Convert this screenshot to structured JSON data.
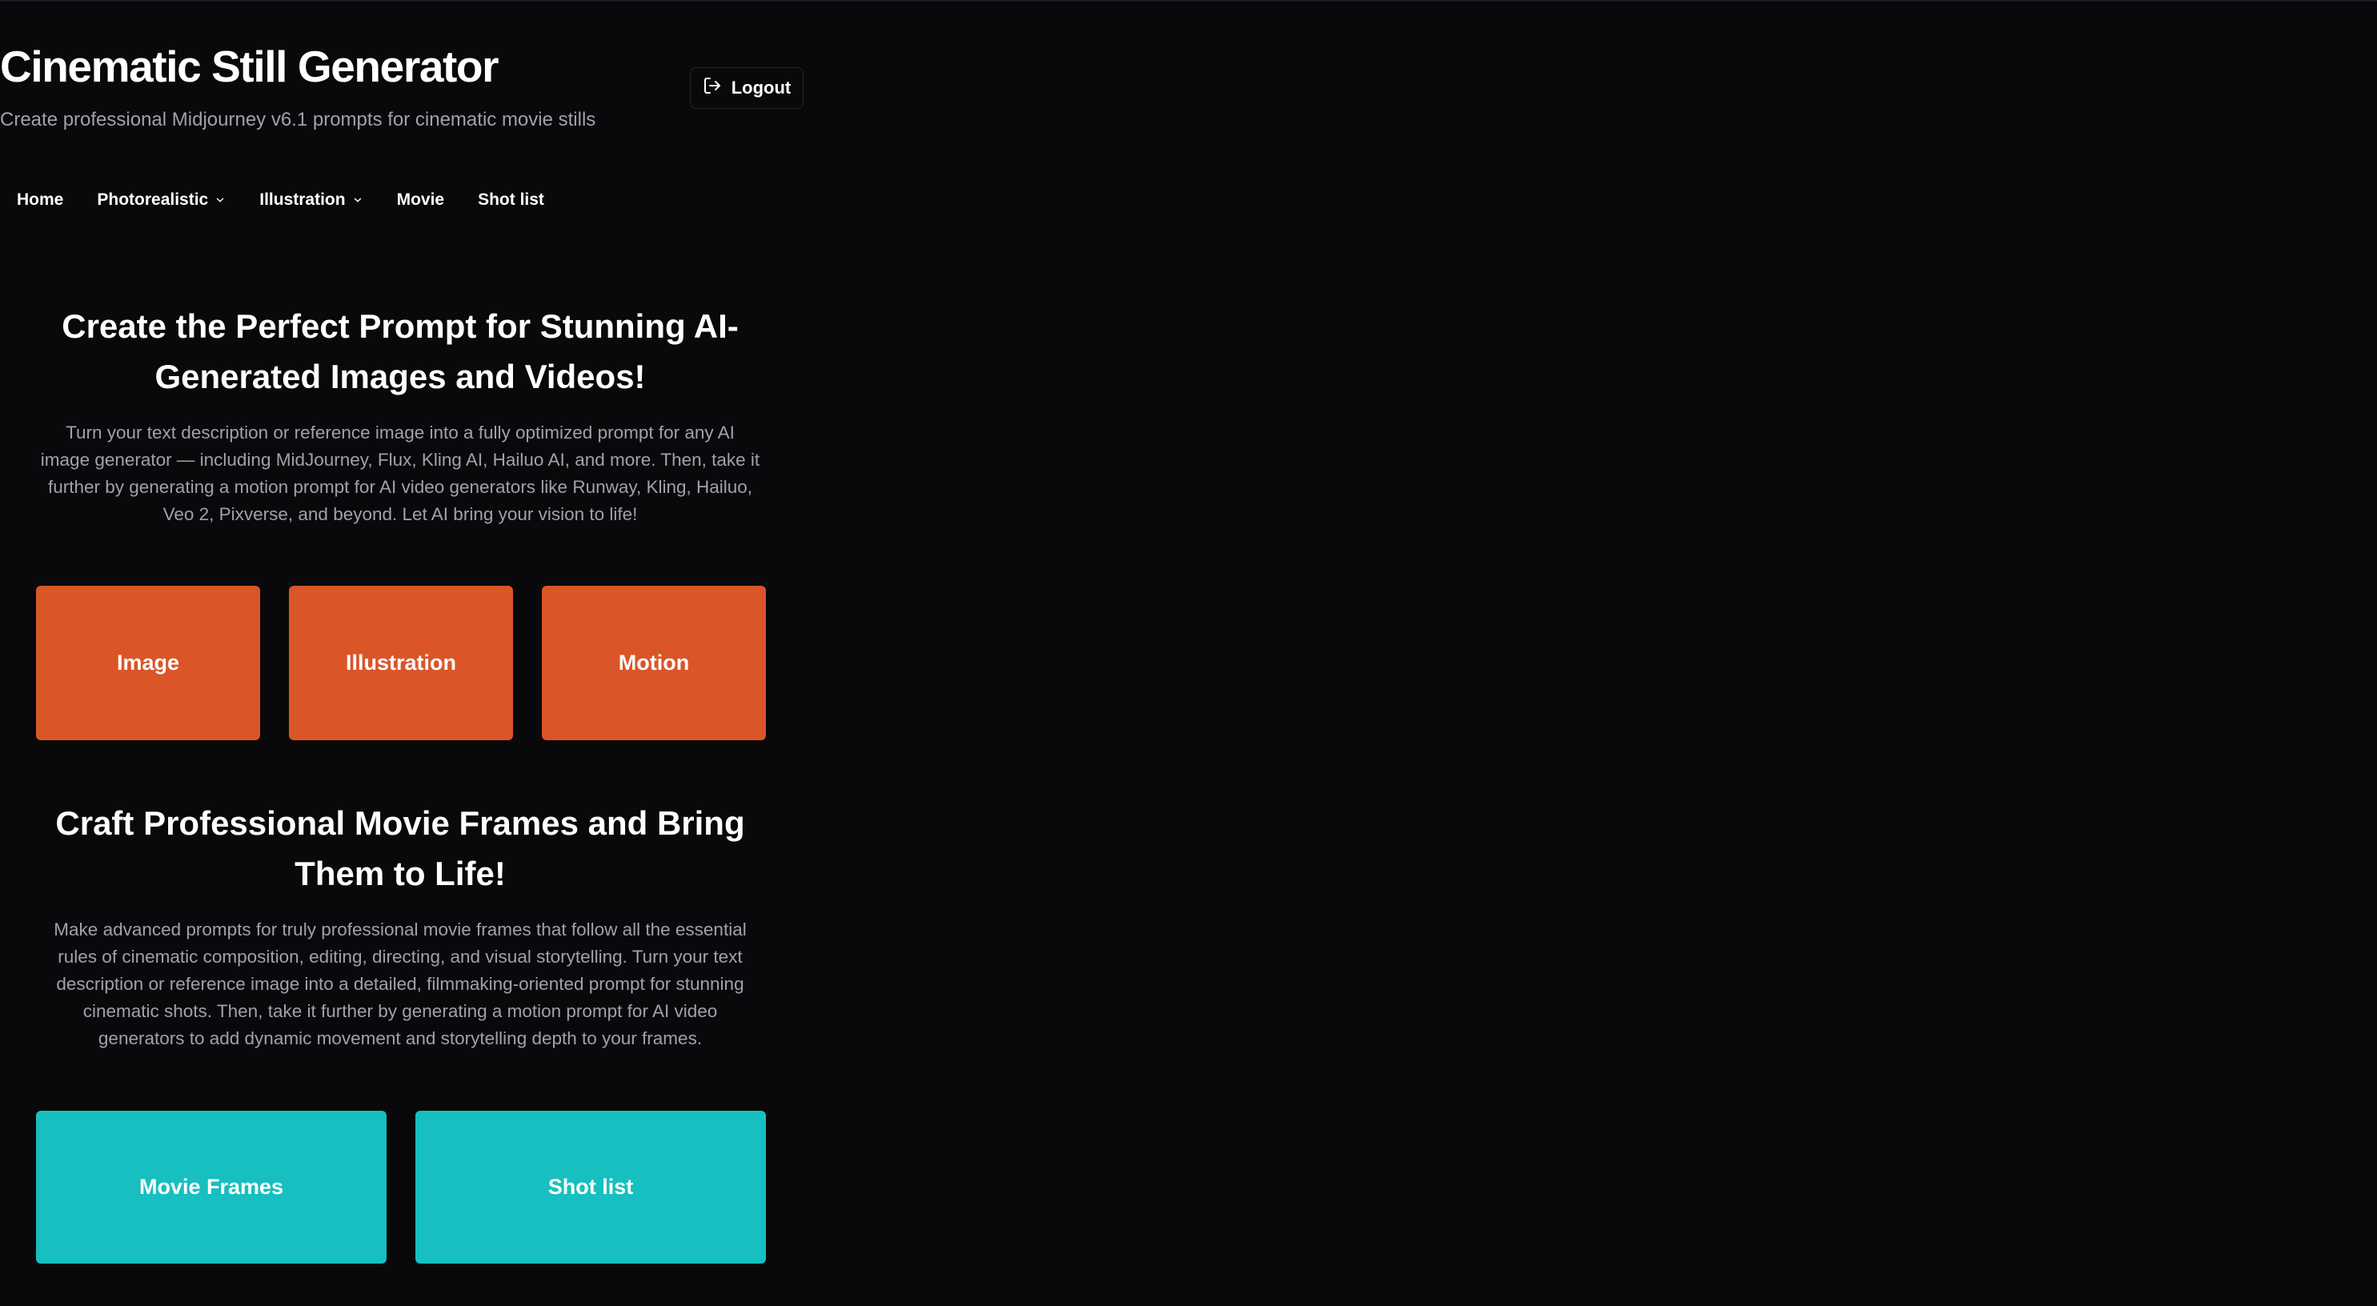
{
  "header": {
    "title": "Cinematic Still Generator",
    "subtitle": "Create professional Midjourney v6.1 prompts for cinematic movie stills",
    "logout_label": "Logout"
  },
  "nav": {
    "items": [
      {
        "label": "Home",
        "has_dropdown": false
      },
      {
        "label": "Photorealistic",
        "has_dropdown": true
      },
      {
        "label": "Illustration",
        "has_dropdown": true
      },
      {
        "label": "Movie",
        "has_dropdown": false
      },
      {
        "label": "Shot list",
        "has_dropdown": false
      }
    ]
  },
  "section_images": {
    "heading": "Create the Perfect Prompt for Stunning AI-Generated Images and Videos!",
    "description": "Turn your text description or reference image into a fully optimized prompt for any AI image generator — including MidJourney, Flux, Kling AI, Hailuo AI, and more. Then, take it further by generating a motion prompt for AI video generators like Runway, Kling, Hailuo, Veo 2, Pixverse, and beyond. Let AI bring your vision to life!",
    "tiles": [
      "Image",
      "Illustration",
      "Motion"
    ]
  },
  "section_movie": {
    "heading": "Craft Professional Movie Frames and Bring Them to Life!",
    "description": "Make advanced prompts for truly professional movie frames that follow all the essential rules of cinematic composition, editing, directing, and visual storytelling. Turn your text description or reference image into a detailed, filmmaking-oriented prompt for stunning cinematic shots. Then, take it further by generating a motion prompt for AI video generators to add dynamic movement and storytelling depth to your frames.",
    "tiles": [
      "Movie Frames",
      "Shot list"
    ]
  },
  "colors": {
    "background": "#09090b",
    "accent_orange": "#da5528",
    "accent_teal": "#17bfc0",
    "muted_text": "#a1a1aa"
  },
  "icons": {
    "logout": "logout-icon",
    "dropdown": "chevron-down-icon"
  }
}
